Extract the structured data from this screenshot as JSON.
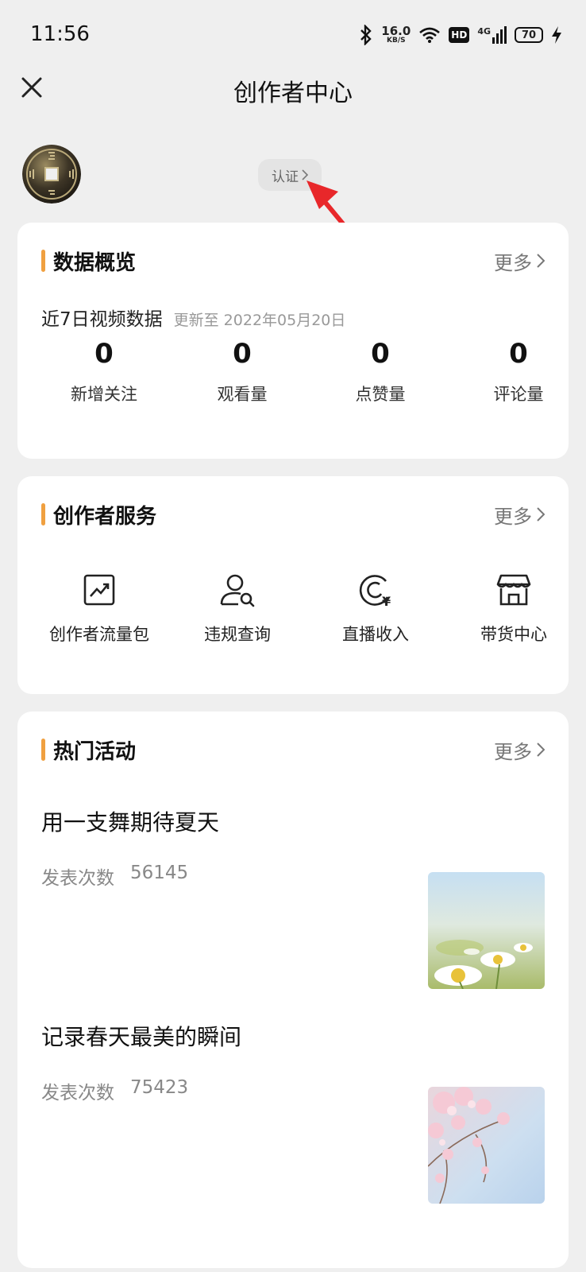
{
  "status": {
    "time": "11:56",
    "net_speed": "16.0",
    "net_unit": "KB/S",
    "hd": "HD",
    "signal": "4G",
    "battery": "70"
  },
  "nav": {
    "title": "创作者中心",
    "close_icon": "close-icon"
  },
  "profile": {
    "cert_label": "认证"
  },
  "overview": {
    "title": "数据概览",
    "more": "更多",
    "sub_label": "近7日视频数据",
    "updated": "更新至 2022年05月20日",
    "stats": [
      {
        "value": "0",
        "label": "新增关注"
      },
      {
        "value": "0",
        "label": "观看量"
      },
      {
        "value": "0",
        "label": "点赞量"
      },
      {
        "value": "0",
        "label": "评论量"
      }
    ]
  },
  "services": {
    "title": "创作者服务",
    "more": "更多",
    "items": [
      {
        "label": "创作者流量包",
        "icon": "trend-chart-icon"
      },
      {
        "label": "违规查询",
        "icon": "user-search-icon"
      },
      {
        "label": "直播收入",
        "icon": "live-income-icon"
      },
      {
        "label": "带货中心",
        "icon": "store-icon"
      }
    ]
  },
  "activities": {
    "title": "热门活动",
    "more": "更多",
    "items": [
      {
        "title": "用一支舞期待夏天",
        "count_label": "发表次数",
        "count": "56145"
      },
      {
        "title": "记录春天最美的瞬间",
        "count_label": "发表次数",
        "count": "75423"
      }
    ]
  },
  "colors": {
    "accent": "#f0a040",
    "background": "#efefef",
    "annotation": "#e8272a"
  }
}
